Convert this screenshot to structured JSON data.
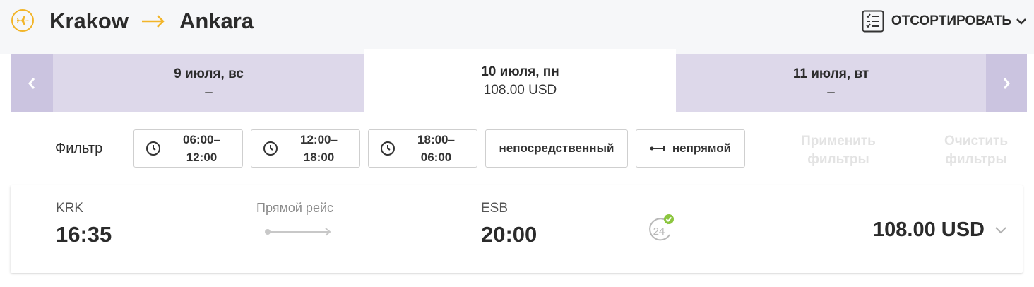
{
  "header": {
    "origin": "Krakow",
    "destination": "Ankara",
    "sort_label": "ОТСОРТИРОВАТЬ"
  },
  "date_tabs": [
    {
      "date": "9 июля, вс",
      "price": "–",
      "active": false
    },
    {
      "date": "10 июля, пн",
      "price": "108.00 USD",
      "active": true
    },
    {
      "date": "11 июля, вт",
      "price": "–",
      "active": false
    }
  ],
  "filters": {
    "label": "Фильтр",
    "times": [
      {
        "line1": "06:00–",
        "line2": "12:00"
      },
      {
        "line1": "12:00–",
        "line2": "18:00"
      },
      {
        "line1": "18:00–",
        "line2": "06:00"
      }
    ],
    "direct": "непосредственный",
    "indirect": "непрямой",
    "apply": {
      "line1": "Применить",
      "line2": "фильтры"
    },
    "clear": {
      "line1": "Очистить",
      "line2": "фильтры"
    }
  },
  "flight": {
    "dep_code": "KRK",
    "dep_time": "16:35",
    "type": "Прямой рейс",
    "arr_code": "ESB",
    "arr_time": "20:00",
    "badge": "24",
    "price": "108.00 USD"
  },
  "colors": {
    "accent_yellow": "#f2b52a",
    "tab_bg": "#ddd8ea",
    "nav_bg": "#cbc4e0",
    "check_green": "#8cc63f"
  },
  "icons": [
    "airplane-icon",
    "arrow-right-icon",
    "sort-list-icon",
    "chevron-down-icon",
    "chevron-left-icon",
    "chevron-right-icon",
    "clock-icon",
    "connection-icon",
    "24h-check-icon"
  ]
}
